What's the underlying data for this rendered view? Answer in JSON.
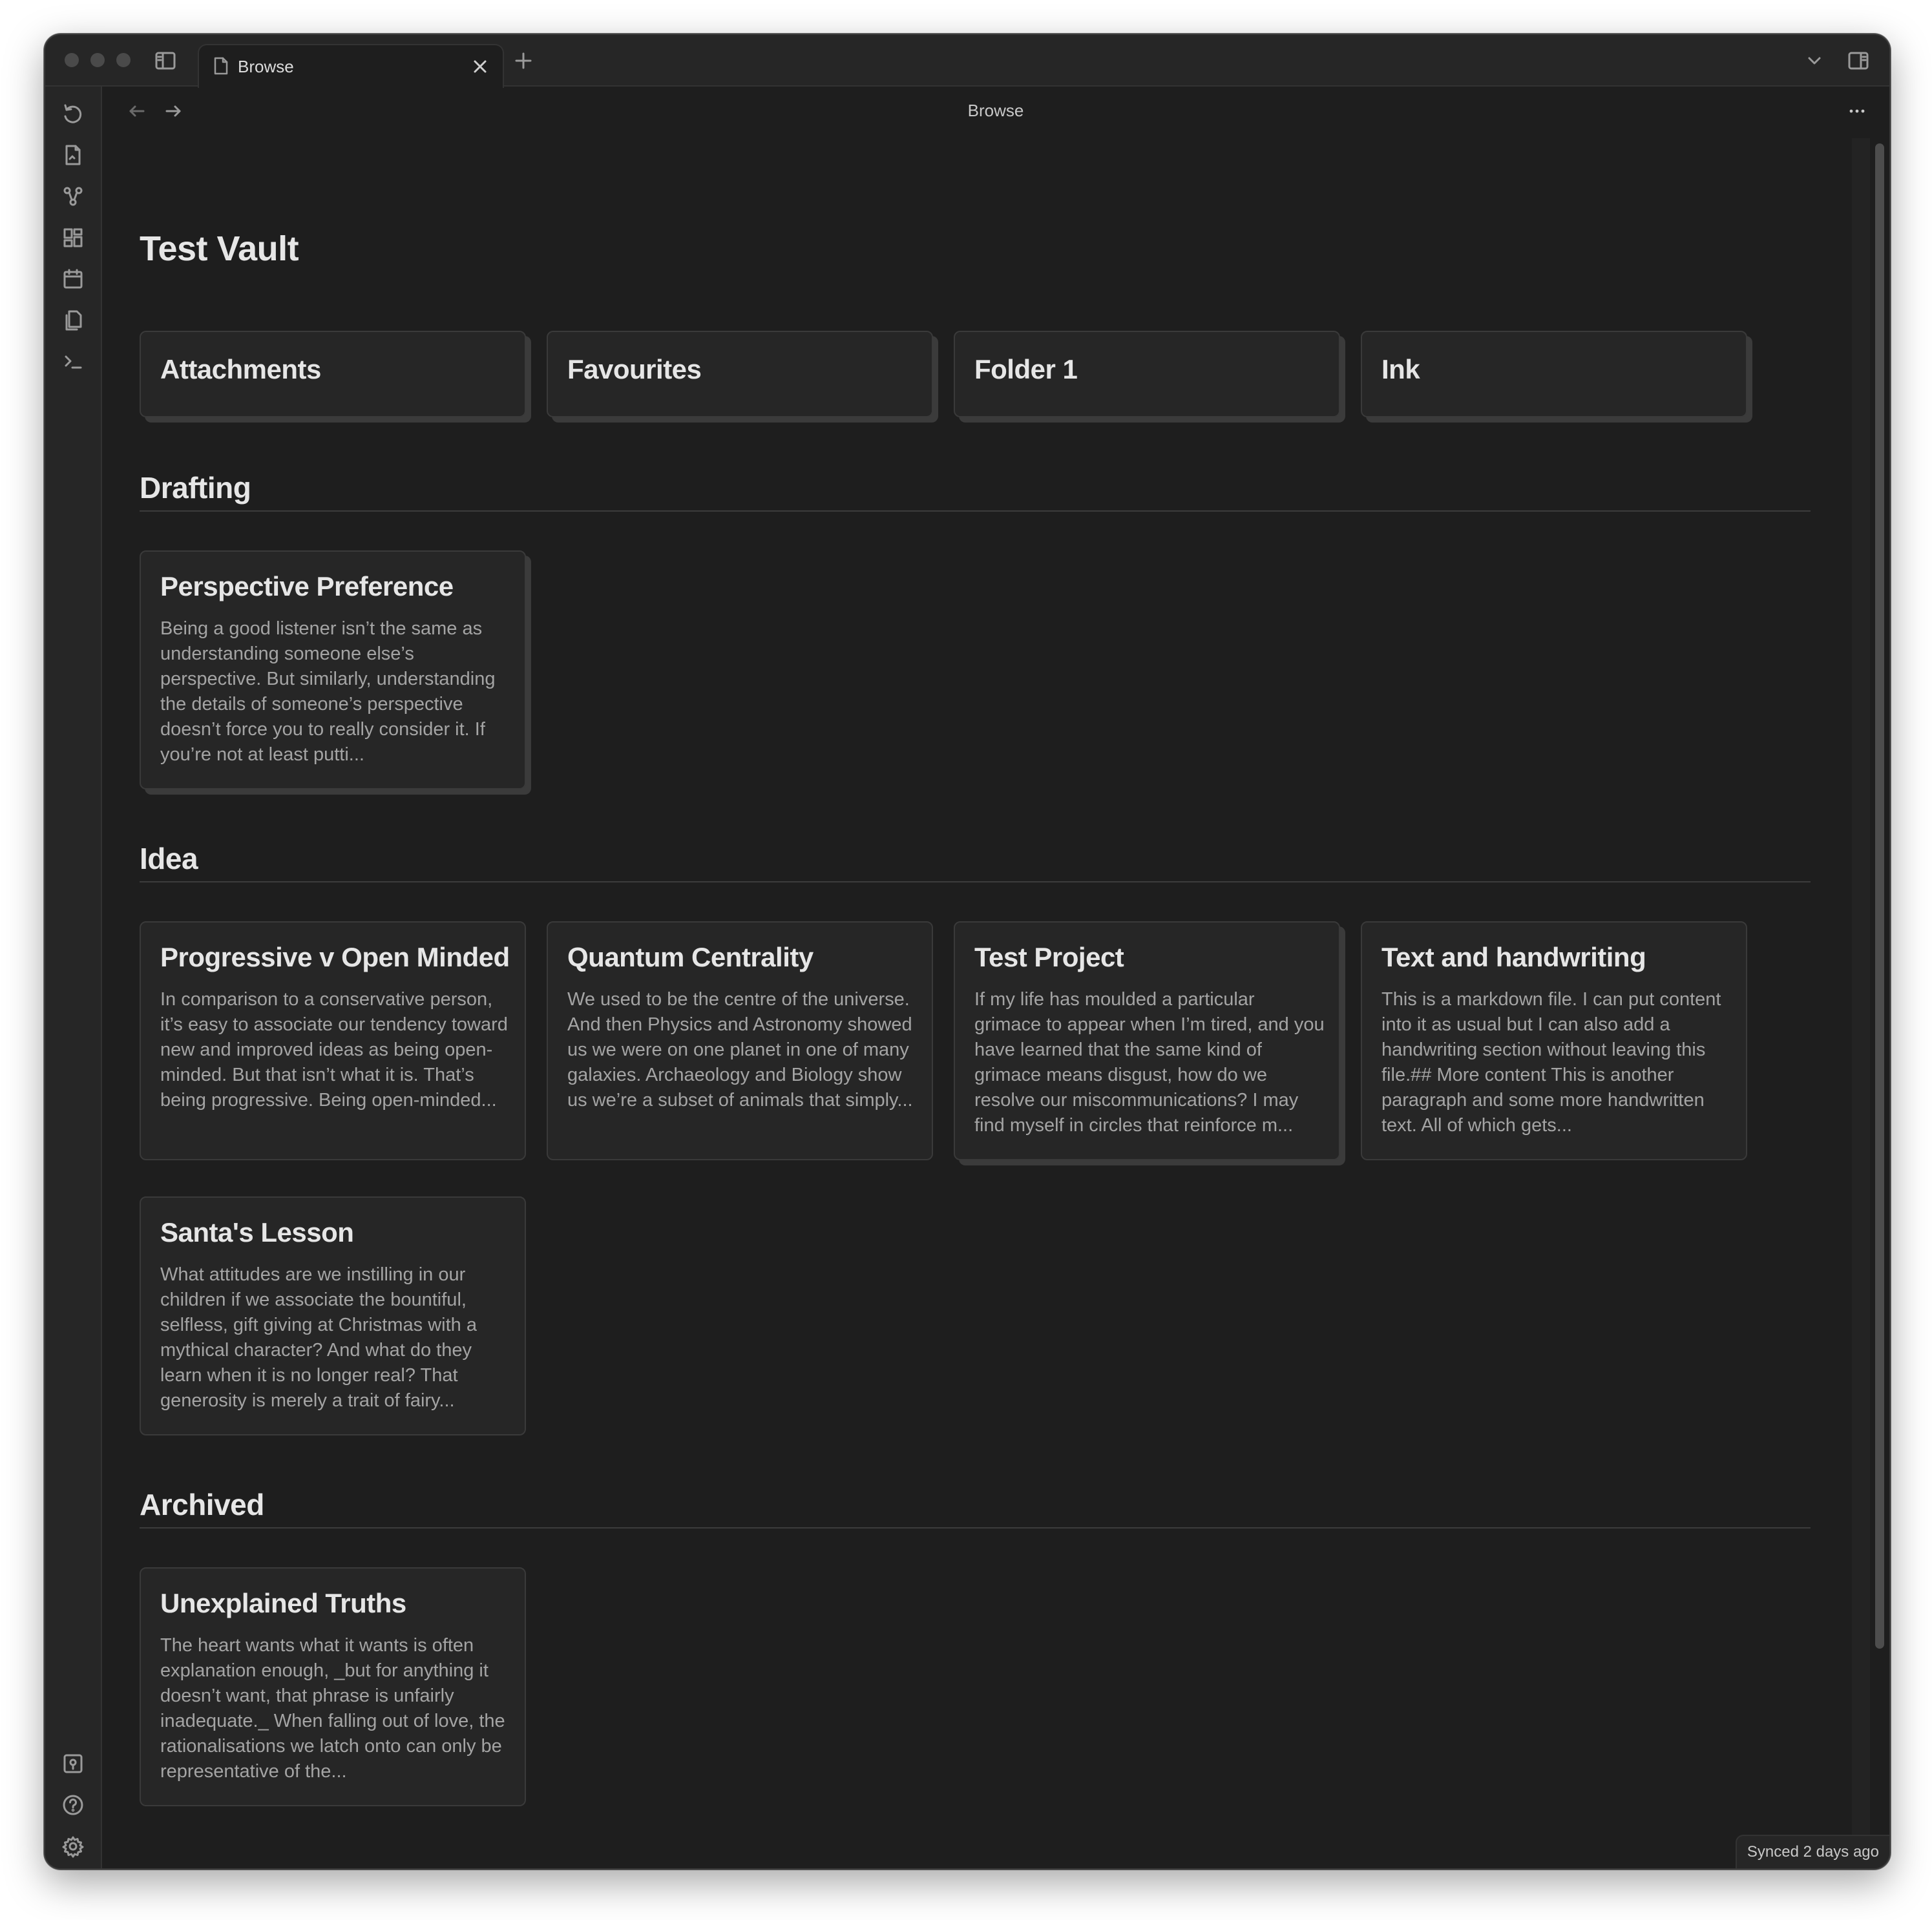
{
  "window": {
    "tab_label": "Browse",
    "view_title": "Browse",
    "status": "Synced 2 days ago"
  },
  "vault": {
    "title": "Test Vault",
    "folders": [
      {
        "label": "Attachments"
      },
      {
        "label": "Favourites"
      },
      {
        "label": "Folder 1"
      },
      {
        "label": "Ink"
      }
    ]
  },
  "sections": [
    {
      "title": "Drafting",
      "notes": [
        {
          "title": "Perspective Preference",
          "excerpt": "Being a good listener isn’t the same as understanding someone else’s perspective. But similarly, understanding the details of someone’s perspective doesn’t force you to really consider it. If you’re not at least putti..."
        }
      ]
    },
    {
      "title": "Idea",
      "notes": [
        {
          "title": "Progressive v Open Minded",
          "excerpt": "In comparison to a conservative person, it’s easy to associate our tendency toward new and improved ideas as being open-minded. But that isn’t what it is. That’s being progressive. Being open-minded..."
        },
        {
          "title": "Quantum Centrality",
          "excerpt": "We used to be the centre of the universe. And then Physics and Astronomy showed us we were on one planet in one of many galaxies. Archaeology and Biology show us we’re a subset of animals that simply..."
        },
        {
          "title": "Test Project",
          "excerpt": "If my life has moulded a particular grimace to appear when I’m tired, and you have learned that the same kind of grimace means disgust, how do we resolve our miscommunications? I may find myself in circles that reinforce m..."
        },
        {
          "title": "Text and handwriting",
          "excerpt": "This is a markdown file. I can put content into it as usual but I can also add a handwriting section without leaving this file.## More content This is another paragraph and some more handwritten text. All of which gets..."
        },
        {
          "title": "Santa's Lesson",
          "excerpt": "What attitudes are we instilling in our children if we associate the bountiful, selfless, gift giving at Christmas with a mythical character? And what do they learn when it is no longer real? That generosity is merely a trait of fairy..."
        }
      ]
    },
    {
      "title": "Archived",
      "notes": [
        {
          "title": "Unexplained Truths",
          "excerpt": "The heart wants what it wants is often explanation enough, _but for anything it doesn’t want, that phrase is unfairly inadequate._ When falling out of love, the rationalisations we latch onto can only be representative of the..."
        }
      ]
    }
  ]
}
